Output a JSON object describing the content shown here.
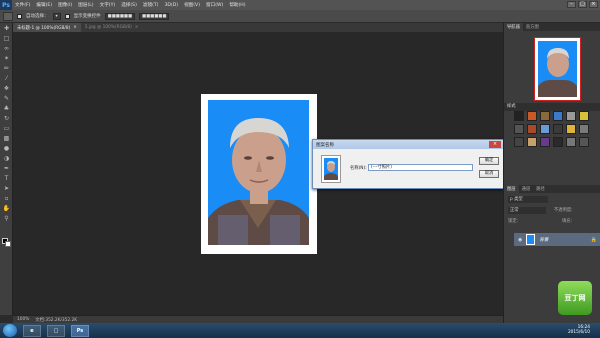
{
  "app": {
    "logo": "Ps",
    "menu": [
      "文件(F)",
      "编辑(E)",
      "图像(I)",
      "图层(L)",
      "文字(Y)",
      "选择(S)",
      "滤镜(T)",
      "3D(D)",
      "视图(V)",
      "窗口(W)",
      "帮助(H)"
    ],
    "window_controls": [
      "–",
      "□",
      "×"
    ]
  },
  "options_bar": {
    "sample_label": "自动选择：",
    "show_transform_label": "显示变换控件"
  },
  "tabs": [
    {
      "label": "未标题-1 @ 100%(RGB/8)",
      "active": true
    },
    {
      "label": "5.jpg @ 100%(RGB/8)",
      "active": false
    }
  ],
  "status_bar": {
    "zoom": "100%",
    "doc_info": "文档:352.2K/352.2K"
  },
  "navigator": {
    "tabs": [
      "导航器",
      "直方图"
    ]
  },
  "swatches_panel": {
    "title": "样式"
  },
  "layers_panel": {
    "tabs": [
      "图层",
      "通道",
      "路径"
    ],
    "kind_label": "p 类型",
    "blend_label": "正常",
    "opacity_label": "不透明度:",
    "lock_label": "锁定:",
    "fill_label": "填充:",
    "layer_name": "背景"
  },
  "dialog": {
    "title": "图案名称",
    "name_label": "名称(N):",
    "name_value": "(---寸照片)",
    "ok_label": "确定",
    "cancel_label": "取消"
  },
  "taskbar": {
    "app_icon": "Ps",
    "time": "16:24",
    "date": "2015/6/10"
  },
  "watermark": {
    "text": "豆丁网"
  },
  "colors": {
    "photo_background": "#1a8cf5",
    "ui_dark": "#282828",
    "dialog_border": "#6a8fbd"
  }
}
